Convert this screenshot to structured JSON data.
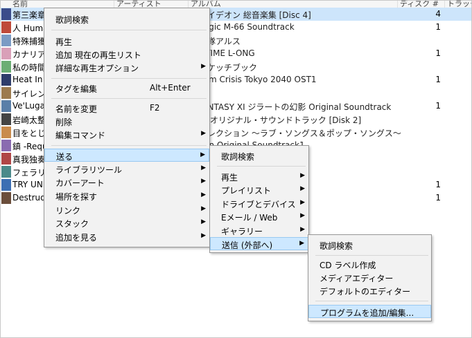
{
  "list": {
    "columns": [
      "名前",
      "アーティスト",
      "アルバム",
      "ディスク #",
      "トラック"
    ],
    "rows": [
      {
        "title": "第三楽章",
        "album": "巨神イデオン 総音楽集 [Disc 4]",
        "disc": "4",
        "selected": true,
        "color": "#3a4c8a"
      },
      {
        "title": "人 Huma",
        "album": "t Magic M-66 Soundtrack",
        "disc": "1",
        "selected": false,
        "color": "#bf4a3a"
      },
      {
        "title": "特殊捕獲",
        "album": "少女隊アルス",
        "disc": "",
        "selected": false,
        "color": "#7b9bc4"
      },
      {
        "title": "カナリア歸",
        "album": "CH TIME L-ONG",
        "disc": "1",
        "selected": false,
        "color": "#d9a0b8"
      },
      {
        "title": "私の時間",
        "album": "ドスケッチブック",
        "disc": "",
        "selected": false,
        "color": "#6cae74"
      },
      {
        "title": "Heat In I",
        "album": "legum Crisis Tokyo 2040 OST1",
        "disc": "1",
        "selected": false,
        "color": "#2f3d6b"
      },
      {
        "title": "サイレン",
        "album": "Trick",
        "disc": "",
        "selected": false,
        "color": "#9c7a4e"
      },
      {
        "title": "Ve'Lugar",
        "album": "L FANTASY XI ジラートの幻影 Original Soundtrack",
        "disc": "1",
        "selected": false,
        "color": "#5a7fa8"
      },
      {
        "title": "岩崎太整",
        "album": "戦線 オリジナル・サウンドトラック [Disk 2]",
        "disc": "",
        "selected": false,
        "color": "#444444"
      },
      {
        "title": "目をとじて",
        "album": "・コレクション ～ラブ・ソングス＆ポップ・ソングス～",
        "disc": "",
        "selected": false,
        "color": "#c98b4c"
      },
      {
        "title": "鎮 -Requ",
        "album": "r Man Original Soundtrack1",
        "disc": "",
        "selected": false,
        "color": "#8a6bb0"
      },
      {
        "title": "真我独奏",
        "album": "",
        "disc": "",
        "selected": false,
        "color": "#b04646"
      },
      {
        "title": "フェラリオ",
        "album": "2]",
        "disc": "",
        "selected": false,
        "color": "#4b8a8a"
      },
      {
        "title": "TRY UNIT",
        "album": "",
        "disc": "1",
        "selected": false,
        "color": "#3c6fb3"
      },
      {
        "title": "Destrudo",
        "album": "ウンドトラック Vol. 2",
        "disc": "1",
        "selected": false,
        "color": "#6b4e3b"
      }
    ]
  },
  "menu1": {
    "lyrics_search": "歌詞検索",
    "play": "再生",
    "add_to_now_playing": "追加 現在の再生リスト",
    "advanced_play_options": "詳細な再生オプション",
    "edit_tags": "タグを編集",
    "edit_tags_shortcut": "Alt+Enter",
    "rename": "名前を変更",
    "rename_shortcut": "F2",
    "delete": "削除",
    "edit_commands": "編集コマンド",
    "send_to": "送る",
    "library_tools": "ライブラリツール",
    "cover_art": "カバーアート",
    "find_location": "場所を探す",
    "link": "リンク",
    "stack": "スタック",
    "show_more": "追加を見る"
  },
  "menu2": {
    "lyrics_search": "歌詞検索",
    "play": "再生",
    "playlist": "プレイリスト",
    "drives_devices": "ドライブとデバイス",
    "email_web": "Eメール / Web",
    "gallery": "ギャラリー",
    "send_external": "送信 (外部へ)"
  },
  "menu3": {
    "lyrics_search": "歌詞検索",
    "cd_label": "CD ラベル作成",
    "media_editor": "メディアエディター",
    "default_editor": "デフォルトのエディター",
    "add_edit_programs": "プログラムを追加/編集..."
  }
}
